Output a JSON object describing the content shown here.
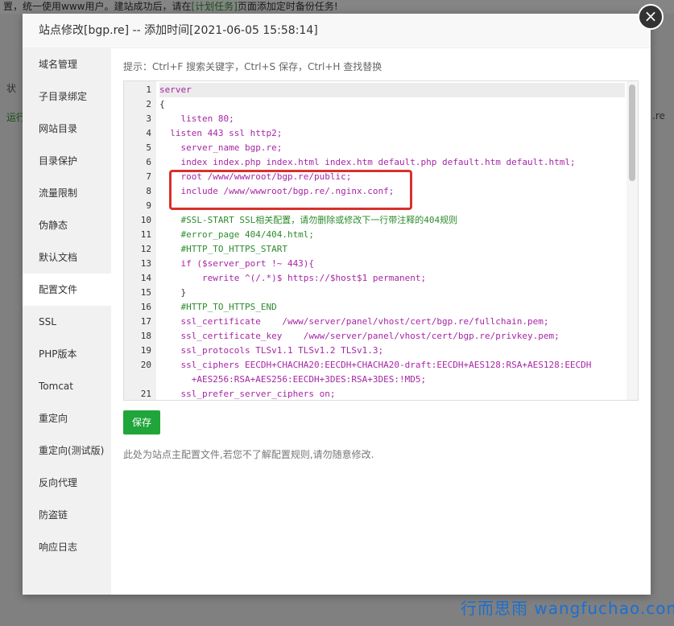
{
  "background": {
    "notice_start": "置，统一使用www用户。建站成功后，请在",
    "notice_link": "[计划任务]",
    "notice_end": "页面添加定时备份任务!",
    "frag_status": "状",
    "frag_running": "运行",
    "frag_domain_tail": ".re"
  },
  "modal": {
    "title": "站点修改[bgp.re] -- 添加时间[2021-06-05 15:58:14]",
    "close_glyph": "×"
  },
  "sidebar": {
    "items": [
      {
        "label": "域名管理"
      },
      {
        "label": "子目录绑定"
      },
      {
        "label": "网站目录"
      },
      {
        "label": "目录保护"
      },
      {
        "label": "流量限制"
      },
      {
        "label": "伪静态"
      },
      {
        "label": "默认文档"
      },
      {
        "label": "配置文件"
      },
      {
        "label": "SSL"
      },
      {
        "label": "PHP版本"
      },
      {
        "label": "Tomcat"
      },
      {
        "label": "重定向"
      },
      {
        "label": "重定向(测试版)"
      },
      {
        "label": "反向代理"
      },
      {
        "label": "防盗链"
      },
      {
        "label": "响应日志"
      }
    ],
    "active_index": 7
  },
  "editor": {
    "tip": "提示：Ctrl+F 搜索关键字，Ctrl+S 保存，Ctrl+H 查找替换",
    "lines": [
      {
        "num": "1",
        "text": "server"
      },
      {
        "num": "2",
        "text": "{"
      },
      {
        "num": "3",
        "text": "    listen 80;"
      },
      {
        "num": "4",
        "text": "  listen 443 ssl http2;"
      },
      {
        "num": "5",
        "text": "    server_name bgp.re;"
      },
      {
        "num": "6",
        "text": "    index index.php index.html index.htm default.php default.htm default.html;"
      },
      {
        "num": "7",
        "text": "    root /www/wwwroot/bgp.re/public;"
      },
      {
        "num": "8",
        "text": "    include /www/wwwroot/bgp.re/.nginx.conf;"
      },
      {
        "num": "9",
        "text": ""
      },
      {
        "num": "10",
        "text": "    #SSL-START SSL相关配置，请勿删除或修改下一行带注释的404规则"
      },
      {
        "num": "11",
        "text": "    #error_page 404/404.html;"
      },
      {
        "num": "12",
        "text": "    #HTTP_TO_HTTPS_START"
      },
      {
        "num": "13",
        "text": "    if ($server_port !~ 443){"
      },
      {
        "num": "14",
        "text": "        rewrite ^(/.*)$ https://$host$1 permanent;"
      },
      {
        "num": "15",
        "text": "    }"
      },
      {
        "num": "16",
        "text": "    #HTTP_TO_HTTPS_END"
      },
      {
        "num": "17",
        "text": "    ssl_certificate    /www/server/panel/vhost/cert/bgp.re/fullchain.pem;"
      },
      {
        "num": "18",
        "text": "    ssl_certificate_key    /www/server/panel/vhost/cert/bgp.re/privkey.pem;"
      },
      {
        "num": "19",
        "text": "    ssl_protocols TLSv1.1 TLSv1.2 TLSv1.3;"
      },
      {
        "num": "20",
        "text": "    ssl_ciphers EECDH+CHACHA20:EECDH+CHACHA20-draft:EECDH+AES128:RSA+AES128:EECDH\n      +AES256:RSA+AES256:EECDH+3DES:RSA+3DES:!MD5;"
      },
      {
        "num": "21",
        "text": "    ssl_prefer_server_ciphers on;"
      }
    ],
    "save_label": "保存",
    "note": "此处为站点主配置文件,若您不了解配置规则,请勿随意修改."
  },
  "watermark": "行而思雨 wangfuchao.com",
  "colors": {
    "accent_green": "#20a53a",
    "highlight_red": "#d9302c",
    "keyword_purple": "#a626a4",
    "comment_green": "#2e8b2e"
  }
}
